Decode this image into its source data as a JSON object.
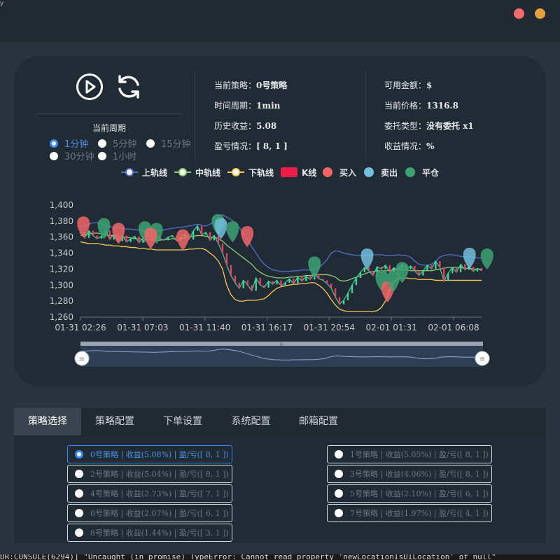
{
  "window": {
    "corner_mark": "y"
  },
  "period": {
    "title": "当前周期",
    "options": [
      {
        "label": "1分钟",
        "selected": true
      },
      {
        "label": "5分钟",
        "selected": false
      },
      {
        "label": "15分钟",
        "selected": false
      },
      {
        "label": "30分钟",
        "selected": false
      },
      {
        "label": "1小时",
        "selected": false
      }
    ]
  },
  "info_mid": [
    {
      "label": "当前策略：",
      "value": "0号策略"
    },
    {
      "label": "时间周期：",
      "value": "1min"
    },
    {
      "label": "历史收益：",
      "value": "5.08"
    },
    {
      "label": "盈亏情况：",
      "value": "[ 8, 1 ]"
    }
  ],
  "info_right": [
    {
      "label": "可用金额：",
      "value": "$"
    },
    {
      "label": "当前价格：",
      "value": "1316.8"
    },
    {
      "label": "委托类型：",
      "value": "没有委托 x1"
    },
    {
      "label": "收益情况：",
      "value": "%"
    }
  ],
  "legend": [
    {
      "label": "上轨线",
      "color": "#5470c6"
    },
    {
      "label": "中轨线",
      "color": "#91cc75"
    },
    {
      "label": "下轨线",
      "color": "#fac858"
    },
    {
      "label": "K线",
      "color": "#ef1d4a"
    },
    {
      "label": "买入",
      "color": "#ee6666"
    },
    {
      "label": "卖出",
      "color": "#73c0de"
    },
    {
      "label": "平仓",
      "color": "#3ba272"
    }
  ],
  "chart_data": {
    "type": "line",
    "yticks": [
      "1,400",
      "1,380",
      "1,360",
      "1,340",
      "1,320",
      "1,300",
      "1,280",
      "1,260"
    ],
    "xticks": [
      "01-31 02:26",
      "01-31 07:03",
      "01-31 11:40",
      "01-31 16:17",
      "01-31 20:54",
      "02-01 01:31",
      "02-01 06:08"
    ],
    "ylim": [
      1260,
      1400
    ],
    "x": [
      0,
      2,
      4,
      6,
      8,
      10,
      12,
      14,
      16,
      18,
      20,
      22,
      24,
      26,
      28,
      30,
      32,
      34,
      36,
      38,
      40,
      42,
      44,
      46,
      48,
      50,
      52,
      54,
      56,
      58,
      60,
      62,
      64,
      66,
      68,
      70,
      72,
      74,
      76,
      78,
      80,
      82,
      84,
      86,
      88,
      90,
      92,
      94,
      96,
      98,
      100,
      102,
      104,
      106,
      108,
      110,
      112,
      114,
      116,
      118,
      120,
      122,
      124,
      126,
      128,
      130,
      132,
      134,
      136,
      138,
      140,
      142,
      144,
      146,
      148,
      150,
      152,
      154,
      156,
      158,
      160,
      162,
      164,
      166,
      168,
      170,
      172,
      174,
      176,
      178,
      180,
      182,
      184,
      186,
      188,
      190,
      192
    ],
    "series": [
      {
        "name": "上轨线",
        "color": "#5470c6",
        "values": [
          1372,
          1374,
          1376,
          1378,
          1378,
          1376,
          1374,
          1373,
          1372,
          1372,
          1371,
          1370,
          1370,
          1369,
          1369,
          1368,
          1368,
          1367,
          1367,
          1368,
          1369,
          1370,
          1371,
          1372,
          1372,
          1373,
          1374,
          1375,
          1376,
          1375,
          1374,
          1376,
          1380,
          1386,
          1388,
          1385,
          1382,
          1378,
          1372,
          1364,
          1356,
          1348,
          1340,
          1332,
          1326,
          1322,
          1319,
          1318,
          1317,
          1317,
          1317,
          1318,
          1318,
          1319,
          1319,
          1319,
          1320,
          1322,
          1326,
          1332,
          1340,
          1343,
          1342,
          1340,
          1339,
          1338,
          1337,
          1337,
          1337,
          1337,
          1338,
          1338,
          1338,
          1337,
          1337,
          1337,
          1338,
          1337,
          1337,
          1335,
          1330,
          1326,
          1325,
          1325,
          1326,
          1330,
          1335,
          1337,
          1338,
          1338,
          1337,
          1336,
          1335,
          1335,
          1335,
          1334,
          1334
        ]
      },
      {
        "name": "中轨线",
        "color": "#91cc75",
        "values": [
          1362,
          1363,
          1364,
          1365,
          1365,
          1364,
          1363,
          1362,
          1362,
          1361,
          1360,
          1360,
          1359,
          1358,
          1358,
          1357,
          1357,
          1356,
          1356,
          1356,
          1357,
          1357,
          1358,
          1358,
          1358,
          1359,
          1360,
          1361,
          1362,
          1362,
          1361,
          1360,
          1360,
          1358,
          1355,
          1350,
          1346,
          1342,
          1338,
          1334,
          1330,
          1326,
          1320,
          1316,
          1313,
          1311,
          1310,
          1309,
          1309,
          1309,
          1310,
          1310,
          1311,
          1311,
          1312,
          1312,
          1313,
          1313,
          1313,
          1313,
          1312,
          1310,
          1306,
          1305,
          1306,
          1308,
          1310,
          1312,
          1314,
          1316,
          1317,
          1318,
          1318,
          1318,
          1318,
          1319,
          1319,
          1319,
          1319,
          1318,
          1318,
          1318,
          1318,
          1318,
          1318,
          1319,
          1320,
          1321,
          1322,
          1322,
          1322,
          1322,
          1321,
          1321,
          1320,
          1320,
          1320
        ]
      },
      {
        "name": "下轨线",
        "color": "#fac858",
        "values": [
          1354,
          1353,
          1352,
          1352,
          1352,
          1351,
          1350,
          1350,
          1349,
          1349,
          1348,
          1348,
          1347,
          1347,
          1346,
          1346,
          1345,
          1345,
          1344,
          1344,
          1344,
          1344,
          1344,
          1344,
          1344,
          1344,
          1345,
          1345,
          1346,
          1346,
          1344,
          1340,
          1336,
          1330,
          1320,
          1300,
          1288,
          1282,
          1280,
          1280,
          1281,
          1281,
          1281,
          1282,
          1283,
          1287,
          1292,
          1296,
          1298,
          1299,
          1300,
          1301,
          1301,
          1302,
          1302,
          1303,
          1303,
          1300,
          1296,
          1290,
          1282,
          1275,
          1270,
          1268,
          1267,
          1267,
          1267,
          1267,
          1267,
          1267,
          1267,
          1268,
          1272,
          1280,
          1294,
          1304,
          1308,
          1309,
          1309,
          1308,
          1308,
          1307,
          1307,
          1307,
          1307,
          1306,
          1306,
          1306,
          1306,
          1306,
          1306,
          1306,
          1306,
          1306,
          1306,
          1306,
          1306
        ]
      },
      {
        "name": "K线",
        "color": "#3fd39a",
        "values": [
          1366,
          1359,
          1368,
          1362,
          1358,
          1361,
          1368,
          1357,
          1364,
          1355,
          1362,
          1354,
          1358,
          1361,
          1353,
          1359,
          1365,
          1356,
          1362,
          1358,
          1356,
          1360,
          1362,
          1355,
          1360,
          1364,
          1357,
          1368,
          1374,
          1363,
          1366,
          1356,
          1362,
          1352,
          1340,
          1325,
          1312,
          1303,
          1296,
          1306,
          1300,
          1293,
          1309,
          1300,
          1297,
          1305,
          1301,
          1306,
          1299,
          1303,
          1308,
          1302,
          1310,
          1305,
          1311,
          1307,
          1314,
          1308,
          1306,
          1302,
          1296,
          1285,
          1276,
          1281,
          1290,
          1300,
          1309,
          1316,
          1322,
          1318,
          1312,
          1323,
          1320,
          1325,
          1316,
          1322,
          1318,
          1326,
          1320,
          1324,
          1318,
          1312,
          1318,
          1325,
          1320,
          1330,
          1322,
          1305,
          1315,
          1322,
          1316,
          1326,
          1319,
          1323,
          1317,
          1321,
          1318
        ]
      }
    ],
    "markers": [
      {
        "type": "buy",
        "color": "#ee6666",
        "x": 2,
        "y": 1370
      },
      {
        "type": "close",
        "color": "#3ba272",
        "x": 16,
        "y": 1368
      },
      {
        "type": "buy",
        "color": "#ee6666",
        "x": 26,
        "y": 1362
      },
      {
        "type": "close",
        "color": "#3ba272",
        "x": 44,
        "y": 1364
      },
      {
        "type": "close",
        "color": "#3ba272",
        "x": 52,
        "y": 1362
      },
      {
        "type": "buy",
        "color": "#ee6666",
        "x": 48,
        "y": 1356
      },
      {
        "type": "buy",
        "color": "#ee6666",
        "x": 70,
        "y": 1354
      },
      {
        "type": "close",
        "color": "#3ba272",
        "x": 94,
        "y": 1373
      },
      {
        "type": "sell",
        "color": "#73c0de",
        "x": 96,
        "y": 1368
      },
      {
        "type": "close",
        "color": "#3ba272",
        "x": 104,
        "y": 1364
      },
      {
        "type": "buy",
        "color": "#ee6666",
        "x": 114,
        "y": 1358
      },
      {
        "type": "close",
        "color": "#3ba272",
        "x": 160,
        "y": 1320
      },
      {
        "type": "sell",
        "color": "#73c0de",
        "x": 196,
        "y": 1330
      },
      {
        "type": "close",
        "color": "#3ba272",
        "x": 206,
        "y": 1303
      },
      {
        "type": "buy",
        "color": "#ee6666",
        "x": 210,
        "y": 1289
      },
      {
        "type": "close",
        "color": "#3ba272",
        "x": 214,
        "y": 1302
      },
      {
        "type": "close",
        "color": "#3ba272",
        "x": 220,
        "y": 1313
      },
      {
        "type": "sell",
        "color": "#73c0de",
        "x": 266,
        "y": 1331
      },
      {
        "type": "close",
        "color": "#3ba272",
        "x": 278,
        "y": 1330
      }
    ]
  },
  "zoom": {
    "handle_left": "≡",
    "handle_right": "≡",
    "grip": "III"
  },
  "tabs": [
    {
      "label": "策略选择",
      "active": true
    },
    {
      "label": "策略配置",
      "active": false
    },
    {
      "label": "下单设置",
      "active": false
    },
    {
      "label": "系统配置",
      "active": false
    },
    {
      "label": "邮箱配置",
      "active": false
    }
  ],
  "strategies": [
    {
      "label": "0号策略 | 收益(5.08%) | 盈/亏([ 8, 1 ])",
      "selected": true
    },
    {
      "label": "1号策略 | 收益(5.05%) | 盈/亏([ 8, 1 ])",
      "selected": false
    },
    {
      "label": "2号策略 | 收益(5.04%) | 盈/亏([ 8, 1 ])",
      "selected": false
    },
    {
      "label": "3号策略 | 收益(4.06%) | 盈/亏([ 8, 1 ])",
      "selected": false
    },
    {
      "label": "4号策略 | 收益(2.73%) | 盈/亏([ 7, 1 ])",
      "selected": false
    },
    {
      "label": "5号策略 | 收益(2.10%) | 盈/亏([ 6, 1 ])",
      "selected": false
    },
    {
      "label": "6号策略 | 收益(2.07%) | 盈/亏([ 6, 1 ])",
      "selected": false
    },
    {
      "label": "7号策略 | 收益(1.97%) | 盈/亏([ 4, 1 ])",
      "selected": false
    },
    {
      "label": "8号策略 | 收益(1.44%) | 盈/亏([ 3, 1 ])",
      "selected": false
    }
  ],
  "console_text": "DR:CONSOLE(6294)] \"Uncaught (in promise) TypeError: Cannot read property 'newLocationIsUILocation' of null\""
}
